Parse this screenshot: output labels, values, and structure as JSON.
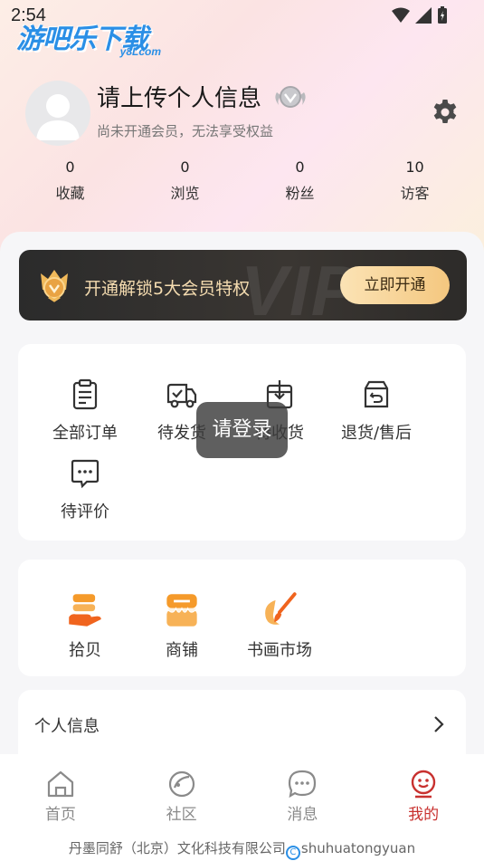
{
  "status_bar": {
    "time": "2:54"
  },
  "watermark": {
    "logo_main": "游吧乐下载",
    "logo_sub": "y8Lcom",
    "footer_text": "丹墨同舒（北京）文化科技有限公司",
    "footer_c": "C",
    "footer_site": "shuhuatongyuan"
  },
  "profile": {
    "username": "请上传个人信息",
    "member_tip": "尚未开通会员，无法享受权益"
  },
  "stats": [
    {
      "value": "0",
      "label": "收藏"
    },
    {
      "value": "0",
      "label": "浏览"
    },
    {
      "value": "0",
      "label": "粉丝"
    },
    {
      "value": "10",
      "label": "访客"
    }
  ],
  "vip": {
    "bg_text": "VIP",
    "promo": "开通解锁5大会员特权",
    "button": "立即开通"
  },
  "orders": [
    {
      "label": "全部订单",
      "icon": "clipboard-icon"
    },
    {
      "label": "待发货",
      "icon": "truck-icon"
    },
    {
      "label": "待收货",
      "icon": "box-icon"
    },
    {
      "label": "退货/售后",
      "icon": "return-icon"
    },
    {
      "label": "待评价",
      "icon": "comment-icon"
    }
  ],
  "services": [
    {
      "label": "拾贝",
      "icon": "shell-stack-icon"
    },
    {
      "label": "商铺",
      "icon": "store-icon"
    },
    {
      "label": "书画市场",
      "icon": "brush-icon"
    }
  ],
  "personal_info": {
    "label": "个人信息"
  },
  "toast": {
    "text": "请登录"
  },
  "tabs": [
    {
      "label": "首页",
      "icon": "home-icon"
    },
    {
      "label": "社区",
      "icon": "community-icon"
    },
    {
      "label": "消息",
      "icon": "message-icon"
    },
    {
      "label": "我的",
      "icon": "me-icon"
    }
  ],
  "colors": {
    "accent": "#c8312f",
    "vip_gold": "#f4c77f",
    "service_orange": "#f59a2a"
  }
}
